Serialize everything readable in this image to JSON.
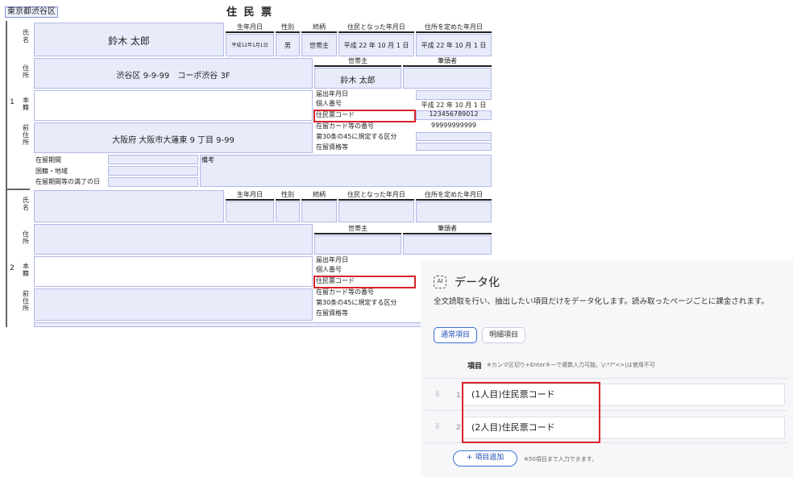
{
  "document": {
    "municipality": "東京都渋谷区",
    "title": "住 民 票",
    "person_headers": [
      "生年月日",
      "性別",
      "続柄",
      "住民となった年月日",
      "住所を定めた年月日"
    ],
    "household_headers": [
      "世帯主",
      "筆頭者"
    ],
    "row_labels": {
      "name": "氏名",
      "address": "住所",
      "domicile": "本籍",
      "prev_address": "前住所"
    },
    "side_labels": [
      "届出年月日",
      "個人番号",
      "住民票コード",
      "在留カード等の番号",
      "第30条の45に規定する区分",
      "在留資格等"
    ],
    "residency_labels": [
      "在留期間",
      "国籍・地域",
      "在留期間等の満了の日"
    ],
    "remarks_label": "備考",
    "persons": [
      {
        "index": "1",
        "name": "鈴木 太郎",
        "birth": "平成12年1月1日",
        "sex": "男",
        "relation": "世帯主",
        "became_resident": "平成 22 年 10 月 1 日",
        "address_fixed": "平成 22 年 10 月 1 日",
        "address": "渋谷区 9-9-99　コーポ渋谷 3F",
        "head_of_household": "鈴木 太郎",
        "prev_address": "大阪府 大阪市大蓮東 9 丁目 9-99",
        "notified_date": "平成 22 年 10 月 1 日",
        "personal_number": "123456789012",
        "resident_card_number": "99999999999"
      },
      {
        "index": "2"
      }
    ]
  },
  "panel": {
    "ai_badge": "AI",
    "title": "データ化",
    "description": "全文読取を行い、抽出したい項目だけをデータ化します。読み取ったページごとに課金されます。",
    "tabs": [
      "通常項目",
      "明細項目"
    ],
    "items_label": "項目",
    "items_hint": "※カンマ区切り+Enterキーで複数入力可能。\\/:*?\"<>|は使用不可",
    "items": [
      {
        "number": "1",
        "value": "(1人目)住民票コード"
      },
      {
        "number": "2",
        "value": "(2人目)住民票コード"
      }
    ],
    "add_button": "+ 項目追加",
    "add_hint": "※50項目まで入力できます。"
  }
}
